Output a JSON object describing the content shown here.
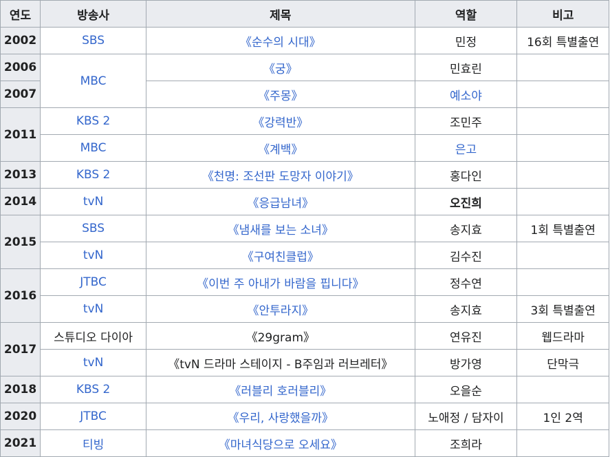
{
  "headers": {
    "year": "연도",
    "broadcaster": "방송사",
    "title": "제목",
    "role": "역할",
    "note": "비고"
  },
  "rows": [
    {
      "year": "2002",
      "broadcaster": "SBS",
      "title": "《순수의 시대》",
      "role": "민정",
      "note": "16회 특별출연"
    },
    {
      "year": "2006",
      "broadcaster": "MBC",
      "title": "《궁》",
      "role": "민효린",
      "note": ""
    },
    {
      "year": "2007",
      "broadcaster": "",
      "title": "《주몽》",
      "role": "예소야",
      "note": ""
    },
    {
      "year": "2011",
      "broadcaster": "KBS 2",
      "title": "《강력반》",
      "role": "조민주",
      "note": ""
    },
    {
      "year": "",
      "broadcaster": "MBC",
      "title": "《계백》",
      "role": "은고",
      "note": ""
    },
    {
      "year": "2013",
      "broadcaster": "KBS 2",
      "title": "《천명: 조선판 도망자 이야기》",
      "role": "홍다인",
      "note": ""
    },
    {
      "year": "2014",
      "broadcaster": "tvN",
      "title": "《응급남녀》",
      "role": "오진희",
      "note": ""
    },
    {
      "year": "2015",
      "broadcaster": "SBS",
      "title": "《냄새를 보는 소녀》",
      "role": "송지효",
      "note": "1회 특별출연"
    },
    {
      "year": "",
      "broadcaster": "tvN",
      "title": "《구여친클럽》",
      "role": "김수진",
      "note": ""
    },
    {
      "year": "2016",
      "broadcaster": "JTBC",
      "title": "《이번 주 아내가 바람을 핍니다》",
      "role": "정수연",
      "note": ""
    },
    {
      "year": "",
      "broadcaster": "tvN",
      "title": "《안투라지》",
      "role": "송지효",
      "note": "3회 특별출연"
    },
    {
      "year": "2017",
      "broadcaster": "스튜디오 다이아",
      "title": "《29gram》",
      "role": "연유진",
      "note": "웹드라마"
    },
    {
      "year": "",
      "broadcaster": "tvN",
      "title": "《tvN 드라마 스테이지 - B주임과 러브레터》",
      "role": "방가영",
      "note": "단막극"
    },
    {
      "year": "2018",
      "broadcaster": "KBS 2",
      "title": "《러블리 호러블리》",
      "role": "오을순",
      "note": ""
    },
    {
      "year": "2020",
      "broadcaster": "JTBC",
      "title": "《우리, 사랑했을까》",
      "role": "노애정 / 담자이",
      "note": "1인 2역"
    },
    {
      "year": "2021",
      "broadcaster": "티빙",
      "title": "《마녀식당으로 오세요》",
      "role": "조희라",
      "note": ""
    }
  ],
  "colors": {
    "link": "#3366cc",
    "header_bg": "#eaecf0",
    "border": "#a2a9b1",
    "text": "#202122"
  }
}
